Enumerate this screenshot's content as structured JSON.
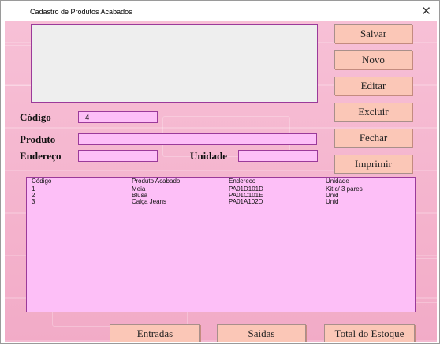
{
  "window": {
    "title": "Cadastro de  Produtos Acabados",
    "close_glyph": "✕"
  },
  "buttons": {
    "salvar": "Salvar",
    "novo": "Novo",
    "editar": "Editar",
    "excluir": "Excluir",
    "fechar": "Fechar",
    "imprimir": "Imprimir",
    "entradas": "Entradas",
    "saidas": "Saidas",
    "total_estoque": "Total do Estoque"
  },
  "form": {
    "codigo_label": "Código",
    "codigo_value": "4",
    "produto_label": "Produto",
    "produto_value": "",
    "endereco_label": "Endereço",
    "endereco_value": "",
    "unidade_label": "Unidade",
    "unidade_value": ""
  },
  "list": {
    "columns": [
      "Código",
      "Produto  Acabado",
      "Endereco",
      "Unidade"
    ],
    "rows": [
      [
        "1",
        "Meia",
        "PA01D101D",
        "Kit c/ 3 pares"
      ],
      [
        "2",
        "Blusa",
        "PA01C101E",
        "Unid"
      ],
      [
        "3",
        "Calça Jeans",
        "PA01A102D",
        "Unid"
      ]
    ]
  },
  "colors": {
    "background": "#f5b6cf",
    "field_fill": "#fdbff7",
    "field_border": "#9b3a9a",
    "button_fill": "#fbc7b7"
  },
  "icons": {
    "close": "close-icon"
  }
}
